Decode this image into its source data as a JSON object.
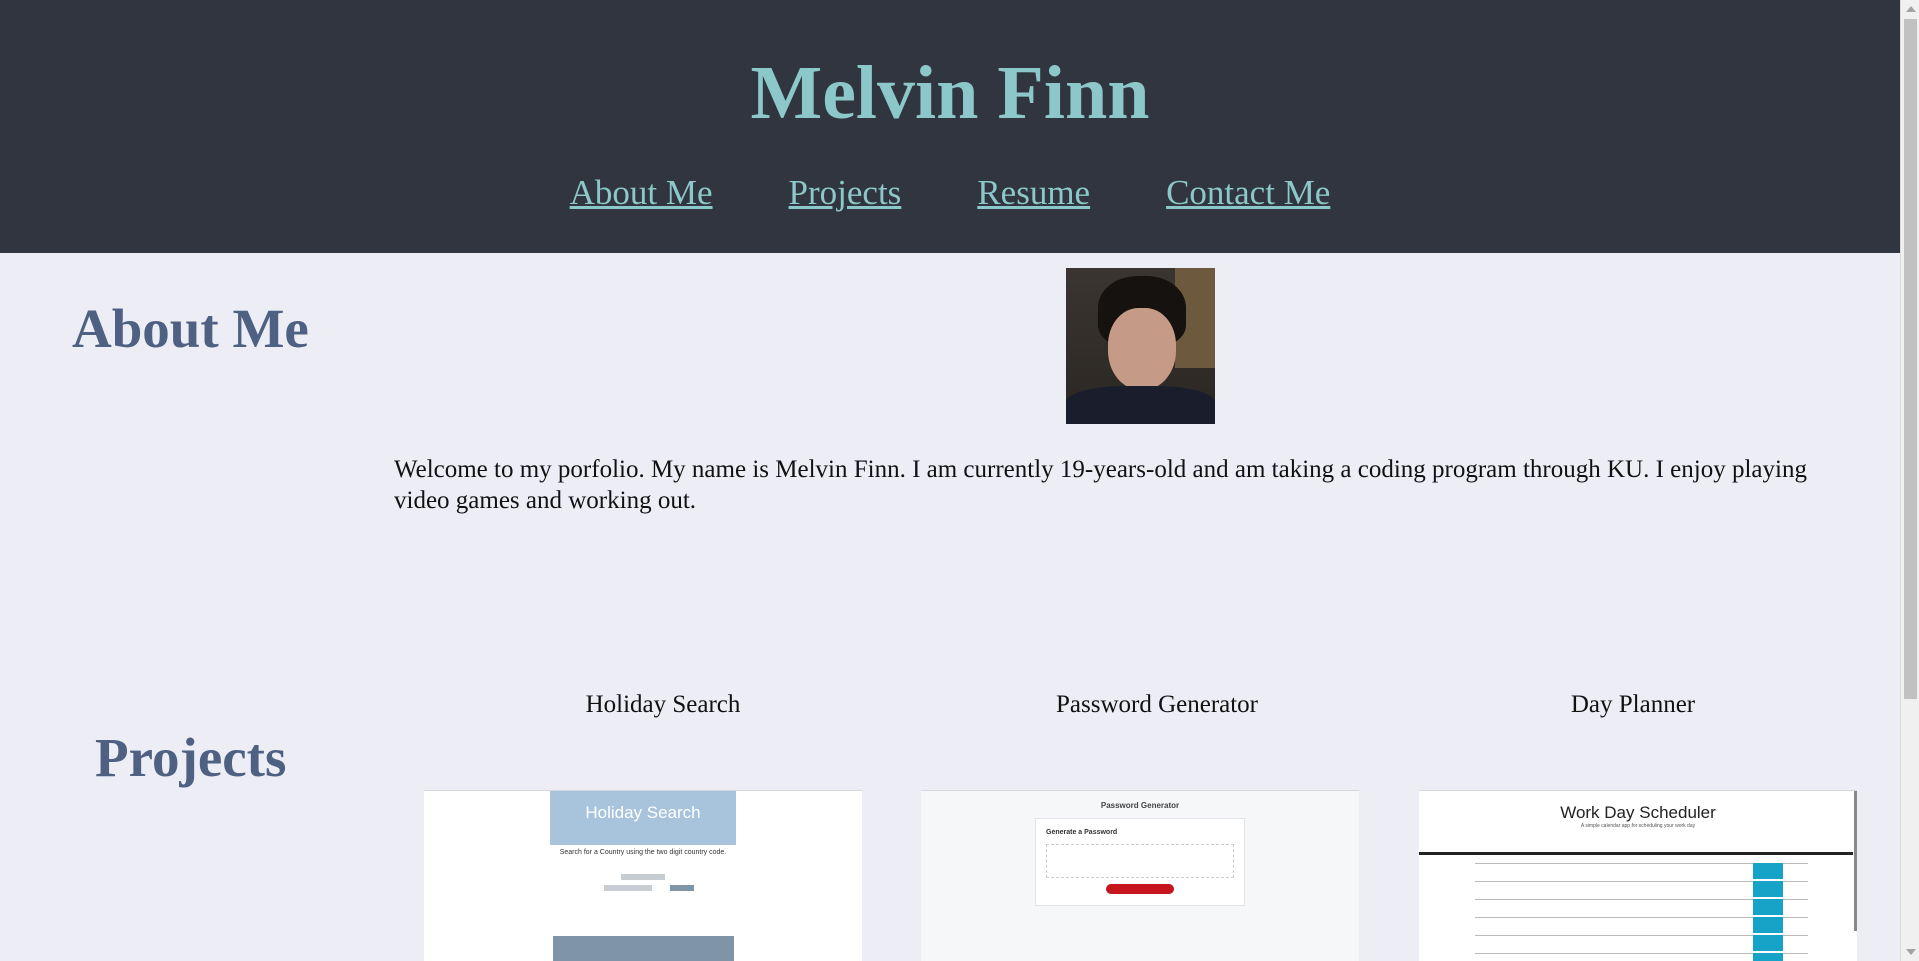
{
  "header": {
    "title": "Melvin Finn",
    "nav": [
      "About Me",
      "Projects",
      "Resume",
      "Contact Me"
    ]
  },
  "about": {
    "heading": "About Me",
    "text": "Welcome to my porfolio. My name is Melvin Finn. I am currently 19-years-old and am taking a coding program through KU. I enjoy playing video games and working out."
  },
  "projects": {
    "heading": "Projects",
    "items": [
      {
        "title": "Holiday Search",
        "thumb_heading": "Holiday Search",
        "thumb_text": "Search for a Country using the two digit country code."
      },
      {
        "title": "Password Generator",
        "thumb_heading": "Password Generator",
        "thumb_text": "Generate a Password"
      },
      {
        "title": "Day Planner",
        "thumb_heading": "Work Day Scheduler",
        "thumb_text": "A simple calendar app for scheduling your work day"
      }
    ]
  },
  "colors": {
    "header_bg": "#31353f",
    "accent": "#8cc8c9",
    "heading": "#4f6183",
    "page_bg": "#edeef5"
  }
}
